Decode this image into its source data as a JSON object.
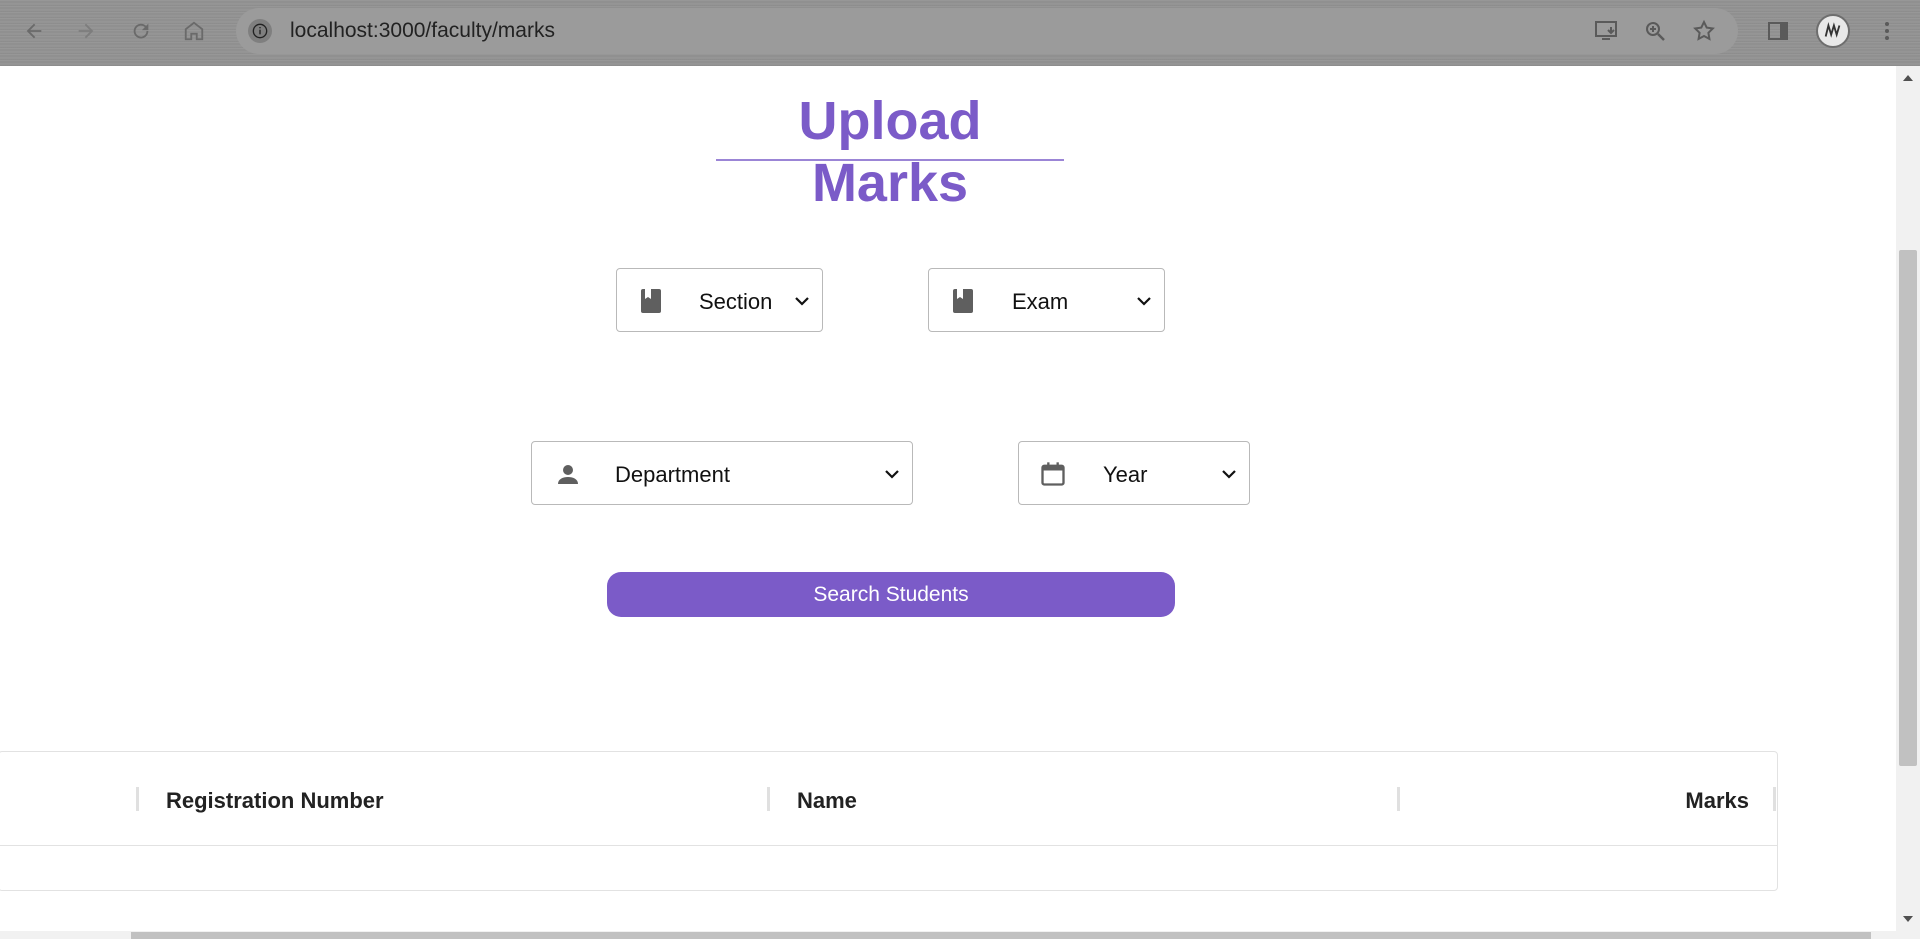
{
  "browser": {
    "url": "localhost:3000/faculty/marks",
    "icons": [
      "back-arrow-icon",
      "forward-arrow-icon",
      "reload-icon",
      "home-icon",
      "site-info-icon",
      "install-app-icon",
      "zoom-icon",
      "bookmark-star-icon",
      "side-panel-icon",
      "profile-avatar",
      "more-vert-icon"
    ]
  },
  "page": {
    "title": "Upload Marks",
    "filters": {
      "section": {
        "label": "Section",
        "icon": "book-icon"
      },
      "exam": {
        "label": "Exam",
        "icon": "book-icon"
      },
      "department": {
        "label": "Department",
        "icon": "person-icon"
      },
      "year": {
        "label": "Year",
        "icon": "calendar-icon"
      }
    },
    "search_button": "Search Students",
    "table": {
      "columns": [
        "Registration Number",
        "Name",
        "Marks"
      ]
    }
  },
  "colors": {
    "accent": "#7b5bc8"
  }
}
